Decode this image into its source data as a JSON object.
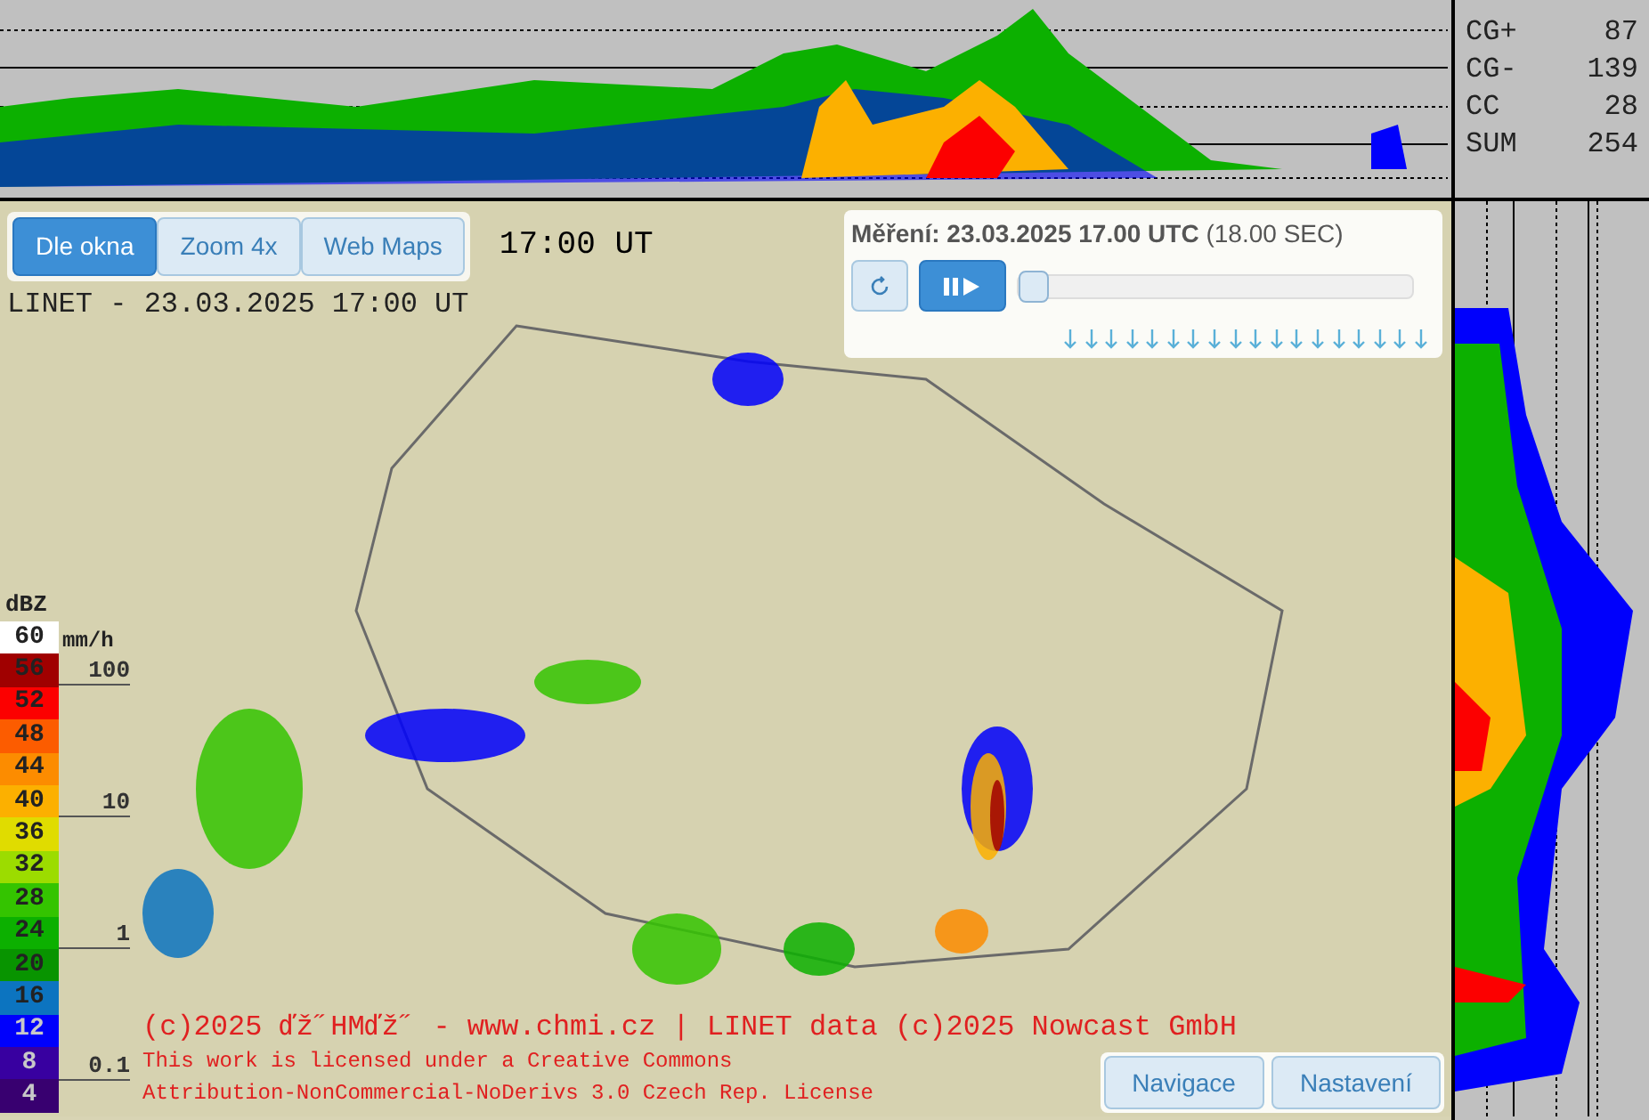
{
  "view_buttons": [
    {
      "label": "Dle okna",
      "selected": true
    },
    {
      "label": "Zoom 4x",
      "selected": false
    },
    {
      "label": "Web Maps",
      "selected": false
    }
  ],
  "map_header": {
    "line_1": "17:00 UT",
    "line_2": "LINET - 23.03.2025 17:00 UT"
  },
  "player": {
    "title": "Měření: 23.03.2025 17.00 UTC",
    "local_time": "(18.00 SEC)",
    "level": 0
  },
  "lightning_stats": [
    {
      "label": "CG+",
      "value": "87"
    },
    {
      "label": "CG-",
      "value": "139"
    },
    {
      "label": "CC",
      "value": "28"
    },
    {
      "label": "SUM",
      "value": "254"
    }
  ],
  "legend": {
    "unit": "dBZ",
    "rate_unit": "mm/h",
    "steps": [
      {
        "value": "60",
        "color": "#ffffff"
      },
      {
        "value": "56",
        "color": "#a00000"
      },
      {
        "value": "52",
        "color": "#fc0000"
      },
      {
        "value": "48",
        "color": "#fc5c00"
      },
      {
        "value": "44",
        "color": "#fc8c00"
      },
      {
        "value": "40",
        "color": "#fcb000"
      },
      {
        "value": "36",
        "color": "#e0dc00"
      },
      {
        "value": "32",
        "color": "#9cdc00"
      },
      {
        "value": "28",
        "color": "#34c400"
      },
      {
        "value": "24",
        "color": "#0cb000"
      },
      {
        "value": "20",
        "color": "#089400"
      },
      {
        "value": "16",
        "color": "#0c74c0"
      },
      {
        "value": "12",
        "color": "#0000fc"
      },
      {
        "value": "8",
        "color": "#3800a0"
      },
      {
        "value": "4",
        "color": "#380070"
      }
    ],
    "rates": [
      "100",
      "10",
      "1",
      "0.1"
    ]
  },
  "credits": [
    "(c)2025 ďž˝HMďž˝ - www.chmi.cz | LINET data (c)2025 Nowcast GmbH",
    "This work is licensed under a Creative Commons",
    "Attribution-NonCommercial-NoDerivs 3.0 Czech Rep. License"
  ],
  "bottom_buttons": [
    "Navigace",
    "Nastavení"
  ]
}
